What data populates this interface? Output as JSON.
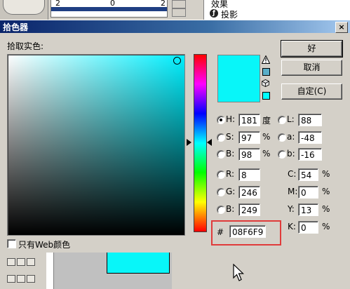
{
  "app": {
    "ruler_labels": [
      "2",
      "0",
      "2"
    ],
    "panel_rows": [
      "效果",
      "投影"
    ]
  },
  "dialog": {
    "title": "拾色器",
    "close_glyph": "×",
    "pick_label": "拾取实色:",
    "buttons": {
      "ok": "好",
      "cancel": "取消",
      "custom": "自定(C)"
    },
    "colors": {
      "current": "#08f6f9",
      "original": "#08f6f9",
      "gamut_swatch": "#5aaec8",
      "web_swatch": "#00ffff",
      "field_hue": "#00f0ff"
    },
    "fields": {
      "H": {
        "label": "H:",
        "value": "181",
        "unit": "度"
      },
      "S": {
        "label": "S:",
        "value": "97",
        "unit": "%"
      },
      "B": {
        "label": "B:",
        "value": "98",
        "unit": "%"
      },
      "R": {
        "label": "R:",
        "value": "8"
      },
      "G": {
        "label": "G:",
        "value": "246"
      },
      "Bl": {
        "label": "B:",
        "value": "249"
      },
      "L": {
        "label": "L:",
        "value": "88"
      },
      "a": {
        "label": "a:",
        "value": "-48"
      },
      "b": {
        "label": "b:",
        "value": "-16"
      },
      "C": {
        "label": "C:",
        "value": "54",
        "unit": "%"
      },
      "M": {
        "label": "M:",
        "value": "0",
        "unit": "%"
      },
      "Y": {
        "label": "Y:",
        "value": "13",
        "unit": "%"
      },
      "K": {
        "label": "K:",
        "value": "0",
        "unit": "%"
      }
    },
    "hex": {
      "label": "#",
      "value": "08F6F9"
    },
    "web_only_label": "只有Web颜色",
    "selected_radio": "H",
    "icons": [
      "warning-icon",
      "cube-icon"
    ]
  }
}
